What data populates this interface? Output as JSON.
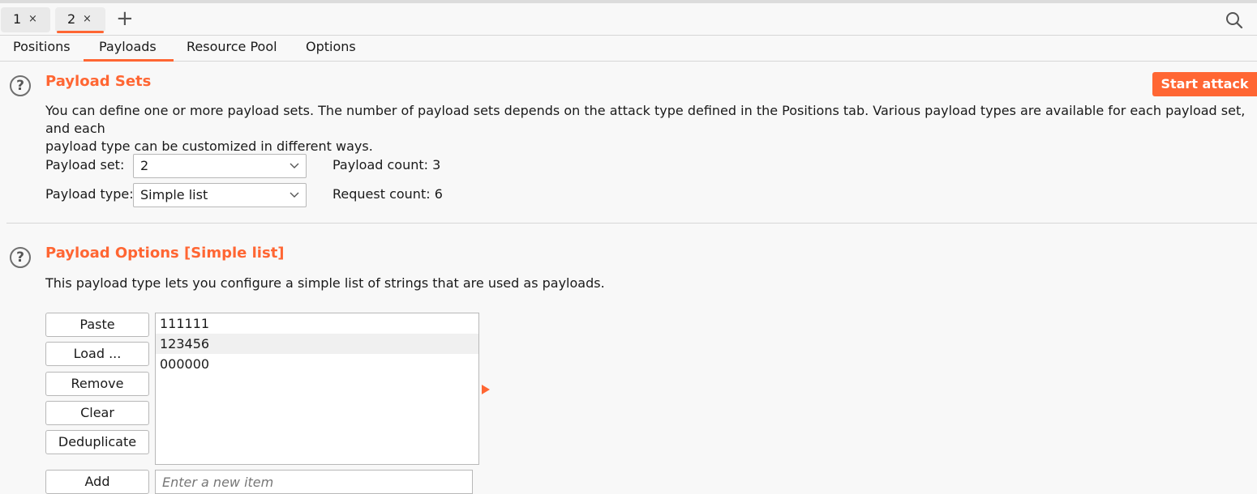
{
  "attack_tabs": [
    {
      "label": "1",
      "close": "×"
    },
    {
      "label": "2",
      "close": "×"
    }
  ],
  "add_tab_label": "+",
  "subtabs": [
    "Positions",
    "Payloads",
    "Resource Pool",
    "Options"
  ],
  "active_subtab": "Payloads",
  "payload_sets": {
    "title": "Payload Sets",
    "description_line1": "You can define one or more payload sets. The number of payload sets depends on the attack type defined in the Positions tab. Various payload types are available for each payload set, and each",
    "description_line2": "payload type can be customized in different ways.",
    "payload_set_label": "Payload set:",
    "payload_set_value": "2",
    "payload_type_label": "Payload type:",
    "payload_type_value": "Simple list",
    "payload_count_label": "Payload count:",
    "payload_count_value": "3",
    "request_count_label": "Request count:",
    "request_count_value": "6",
    "start_attack_label": "Start attack"
  },
  "payload_options": {
    "title": "Payload Options [Simple list]",
    "description": "This payload type lets you configure a simple list of strings that are used as payloads.",
    "buttons": {
      "paste": "Paste",
      "load": "Load ...",
      "remove": "Remove",
      "clear": "Clear",
      "deduplicate": "Deduplicate",
      "add": "Add"
    },
    "items": [
      "111111",
      "123456",
      "000000"
    ],
    "selected_index": 1,
    "new_item_placeholder": "Enter a new item"
  },
  "help_glyph": "?",
  "colors": {
    "accent": "#ff6633"
  },
  "icons": [
    "close-icon",
    "plus-icon",
    "search-icon",
    "help-icon",
    "chevron-down-icon",
    "arrow-right-icon"
  ]
}
